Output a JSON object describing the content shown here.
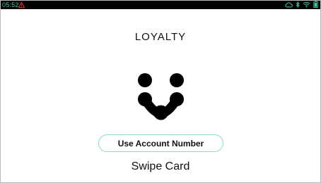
{
  "status_bar": {
    "time": "05:52",
    "alert_icon": "warning-triangle-icon",
    "right_icons": [
      "cloud-icon",
      "bluetooth-icon",
      "wifi-icon",
      "battery-icon"
    ],
    "accent_color": "#48c8a8",
    "alert_color": "#e53935"
  },
  "screen": {
    "title": "LOYALTY",
    "logo_icon": "loyalty-logo-icon",
    "account_button_label": "Use Account Number",
    "swipe_label": "Swipe Card",
    "button_border_color": "#8fd9cc"
  }
}
